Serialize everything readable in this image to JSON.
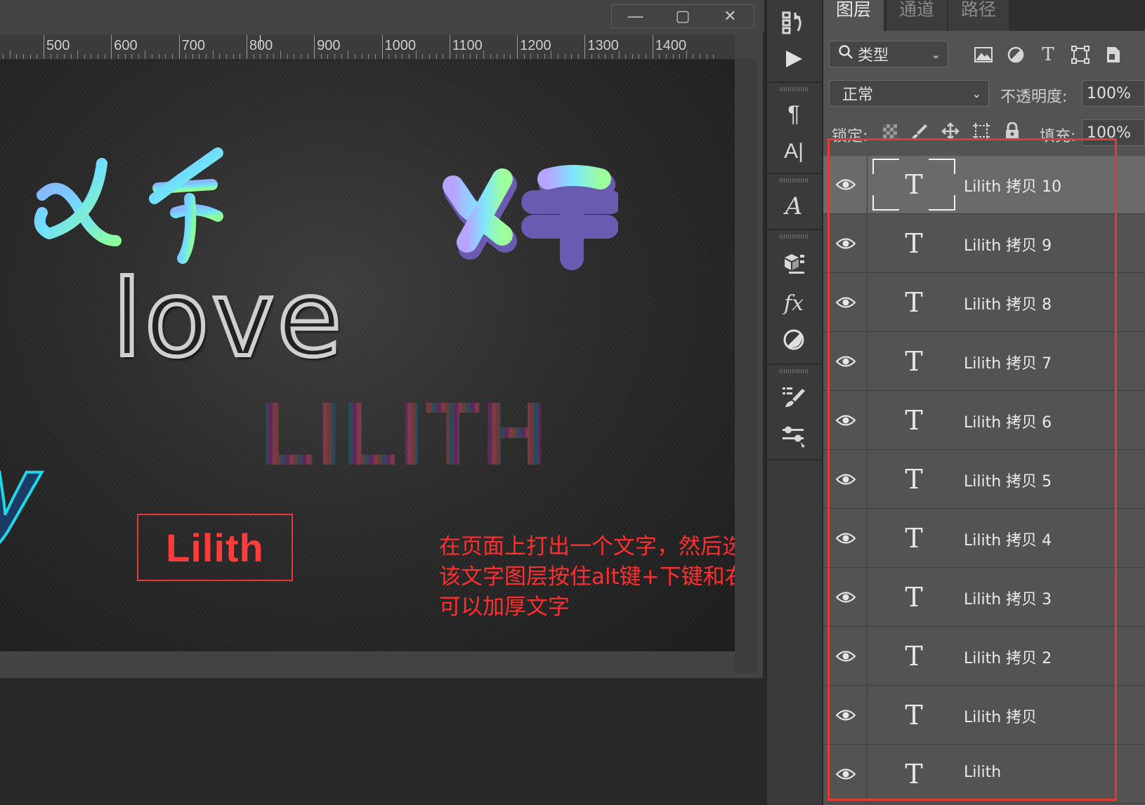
{
  "window": {
    "controls": {
      "minimize": "—",
      "restore": "▢",
      "close": "✕"
    }
  },
  "ruler": {
    "labels": [
      "500",
      "600",
      "700",
      "800",
      "900",
      "1000",
      "1100",
      "1200",
      "1300",
      "1400"
    ]
  },
  "canvas": {
    "text_love": "love",
    "text_lilith_jewel": "LILITH",
    "text_y": "y",
    "selected_text": "Lilith",
    "annotation_lines": [
      "在页面上打出一个文字，然后选择",
      "该文字图层按住alt键+下键和右键交互",
      "可以加厚文字"
    ]
  },
  "tools": [
    {
      "icon": "history-icon"
    },
    {
      "icon": "play-icon"
    },
    {
      "icon": "paragraph-icon"
    },
    {
      "icon": "character-icon"
    },
    {
      "icon": "glyphs-icon"
    },
    {
      "icon": "3d-icon"
    },
    {
      "icon": "fx-icon"
    },
    {
      "icon": "adjustments-icon"
    },
    {
      "icon": "brush-settings-icon"
    },
    {
      "icon": "properties-icon"
    }
  ],
  "layers_panel": {
    "tabs": [
      {
        "label": "图层",
        "active": true
      },
      {
        "label": "通道",
        "active": false
      },
      {
        "label": "路径",
        "active": false
      }
    ],
    "filter_label": "类型",
    "blend_mode": "正常",
    "opacity_label": "不透明度:",
    "opacity_value": "100%",
    "lock_label": "锁定:",
    "fill_label": "填充:",
    "fill_value": "100%",
    "thumb_glyph": "T",
    "layers": [
      {
        "name": "Lilith 拷贝 10",
        "selected": true
      },
      {
        "name": "Lilith 拷贝 9",
        "selected": false
      },
      {
        "name": "Lilith 拷贝 8",
        "selected": false
      },
      {
        "name": "Lilith 拷贝 7",
        "selected": false
      },
      {
        "name": "Lilith 拷贝 6",
        "selected": false
      },
      {
        "name": "Lilith 拷贝 5",
        "selected": false
      },
      {
        "name": "Lilith 拷贝 4",
        "selected": false
      },
      {
        "name": "Lilith 拷贝 3",
        "selected": false
      },
      {
        "name": "Lilith 拷贝 2",
        "selected": false
      },
      {
        "name": "Lilith 拷贝",
        "selected": false
      },
      {
        "name": "Lilith",
        "selected": false
      }
    ]
  },
  "colors": {
    "annotation_red": "#ff2e2e",
    "highlight_red": "#e53935",
    "panel_bg": "#535353"
  }
}
